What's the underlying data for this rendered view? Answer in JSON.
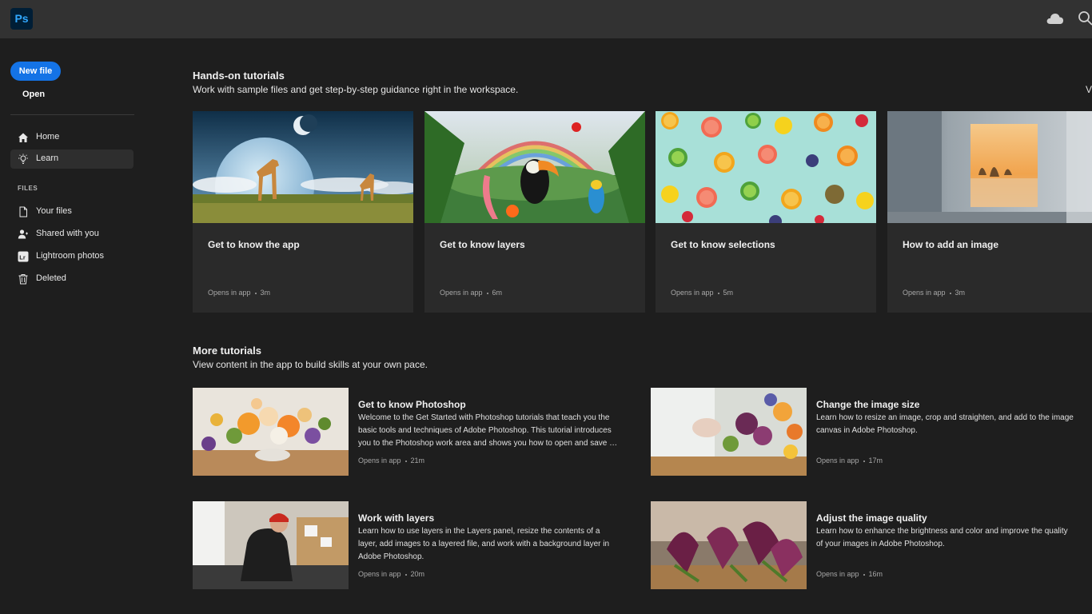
{
  "app": {
    "logo": "Ps"
  },
  "topbar": {
    "icons": [
      "cloud-icon",
      "search-icon"
    ]
  },
  "sidebar": {
    "new_file": "New file",
    "open": "Open",
    "nav": [
      {
        "label": "Home",
        "icon": "home-icon"
      },
      {
        "label": "Learn",
        "icon": "lightbulb-icon",
        "active": true
      }
    ],
    "files_heading": "FILES",
    "files": [
      {
        "label": "Your files",
        "icon": "file-icon"
      },
      {
        "label": "Shared with you",
        "icon": "shared-user-icon"
      },
      {
        "label": "Lightroom photos",
        "icon": "lightroom-icon"
      },
      {
        "label": "Deleted",
        "icon": "trash-icon"
      }
    ]
  },
  "hands_on": {
    "title": "Hands-on tutorials",
    "subtitle": "Work with sample files and get step-by-step guidance right in the workspace.",
    "view_all": "V",
    "cards": [
      {
        "title": "Get to know the app",
        "meta": "Opens in app",
        "duration": "3m"
      },
      {
        "title": "Get to know layers",
        "meta": "Opens in app",
        "duration": "6m"
      },
      {
        "title": "Get to know selections",
        "meta": "Opens in app",
        "duration": "5m"
      },
      {
        "title": "How to add an image",
        "meta": "Opens in app",
        "duration": "3m"
      }
    ]
  },
  "more": {
    "title": "More tutorials",
    "subtitle": "View content in the app to build skills at your own pace.",
    "items": [
      {
        "title": "Get to know Photoshop",
        "desc": "Welcome to the Get Started with Photoshop tutorials that teach you the basic tools and techniques of Adobe Photoshop. This tutorial introduces you to the Photoshop work area and shows you how to open and save …",
        "meta": "Opens in app",
        "duration": "21m"
      },
      {
        "title": "Change the image size",
        "desc": "Learn how to resize an image, crop and straighten, and add to the image canvas in Adobe Photoshop.",
        "meta": "Opens in app",
        "duration": "17m"
      },
      {
        "title": "Work with layers",
        "desc": "Learn how to use layers in the Layers panel, resize the contents of a layer, add images to a layered file, and work with a background layer in Adobe Photoshop.",
        "meta": "Opens in app",
        "duration": "20m"
      },
      {
        "title": "Adjust the image quality",
        "desc": "Learn how to enhance the brightness and color and improve the quality of your images in Adobe Photoshop.",
        "meta": "Opens in app",
        "duration": "16m"
      }
    ]
  },
  "colors": {
    "accent": "#1473e6",
    "background": "#1e1e1e",
    "topbar": "#323232",
    "card": "#2a2a2a"
  }
}
